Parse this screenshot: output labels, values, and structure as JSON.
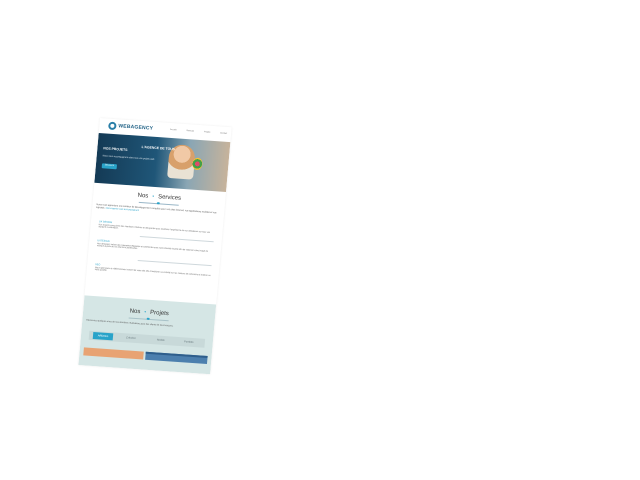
{
  "brand": {
    "name": "WEBAGENCY"
  },
  "nav": [
    {
      "label": "Accueil"
    },
    {
      "label": "Services"
    },
    {
      "label": "Projets"
    },
    {
      "label": "Contact"
    }
  ],
  "hero": {
    "title_a": "NOS PROJETS",
    "title_b": "L'AGENCE DE TOUS",
    "subtitle": "Nous vous accompagnons dans tous vos projets web",
    "cta": "Découvrir"
  },
  "services": {
    "title_a": "Nos",
    "title_b": "Services",
    "intro": "Nous vous apportons une solution de développement complète pour vos sites internet, vos applications mobiles et vos logiciels.",
    "intro_highlight": "Nos experts vous accompagnent",
    "items": [
      {
        "title": "UX DESIGN",
        "text": "Nos experts conçoivent des interfaces intuitives et attrayantes pour améliorer l'expérience de vos utilisateurs sur tous vos supports numériques."
      },
      {
        "title": "UI DESIGN",
        "text": "Nos designers créent des maquettes élégantes et cohérentes avec votre identité visuelle afin de valoriser votre image de marque auprès de vos clients et partenaires."
      },
      {
        "title": "SEO",
        "text": "Nous optimisons le référencement naturel de votre site afin d'améliorer sa visibilité sur les moteurs de recherche et d'attirer un trafic qualifié."
      }
    ]
  },
  "projects": {
    "title_a": "Nos",
    "title_b": "Projets",
    "text": "Découvrez quelques-unes de nos dernières réalisations pour des clients de tous horizons.",
    "filters": [
      {
        "label": "Affiliation"
      },
      {
        "label": "Création"
      },
      {
        "label": "Mobile"
      },
      {
        "label": "Portfolio"
      }
    ],
    "active_filter_index": 0
  },
  "colors": {
    "accent": "#29a3c9",
    "brand_dark": "#1d5f84",
    "projects_bg": "#d5e6e5"
  }
}
